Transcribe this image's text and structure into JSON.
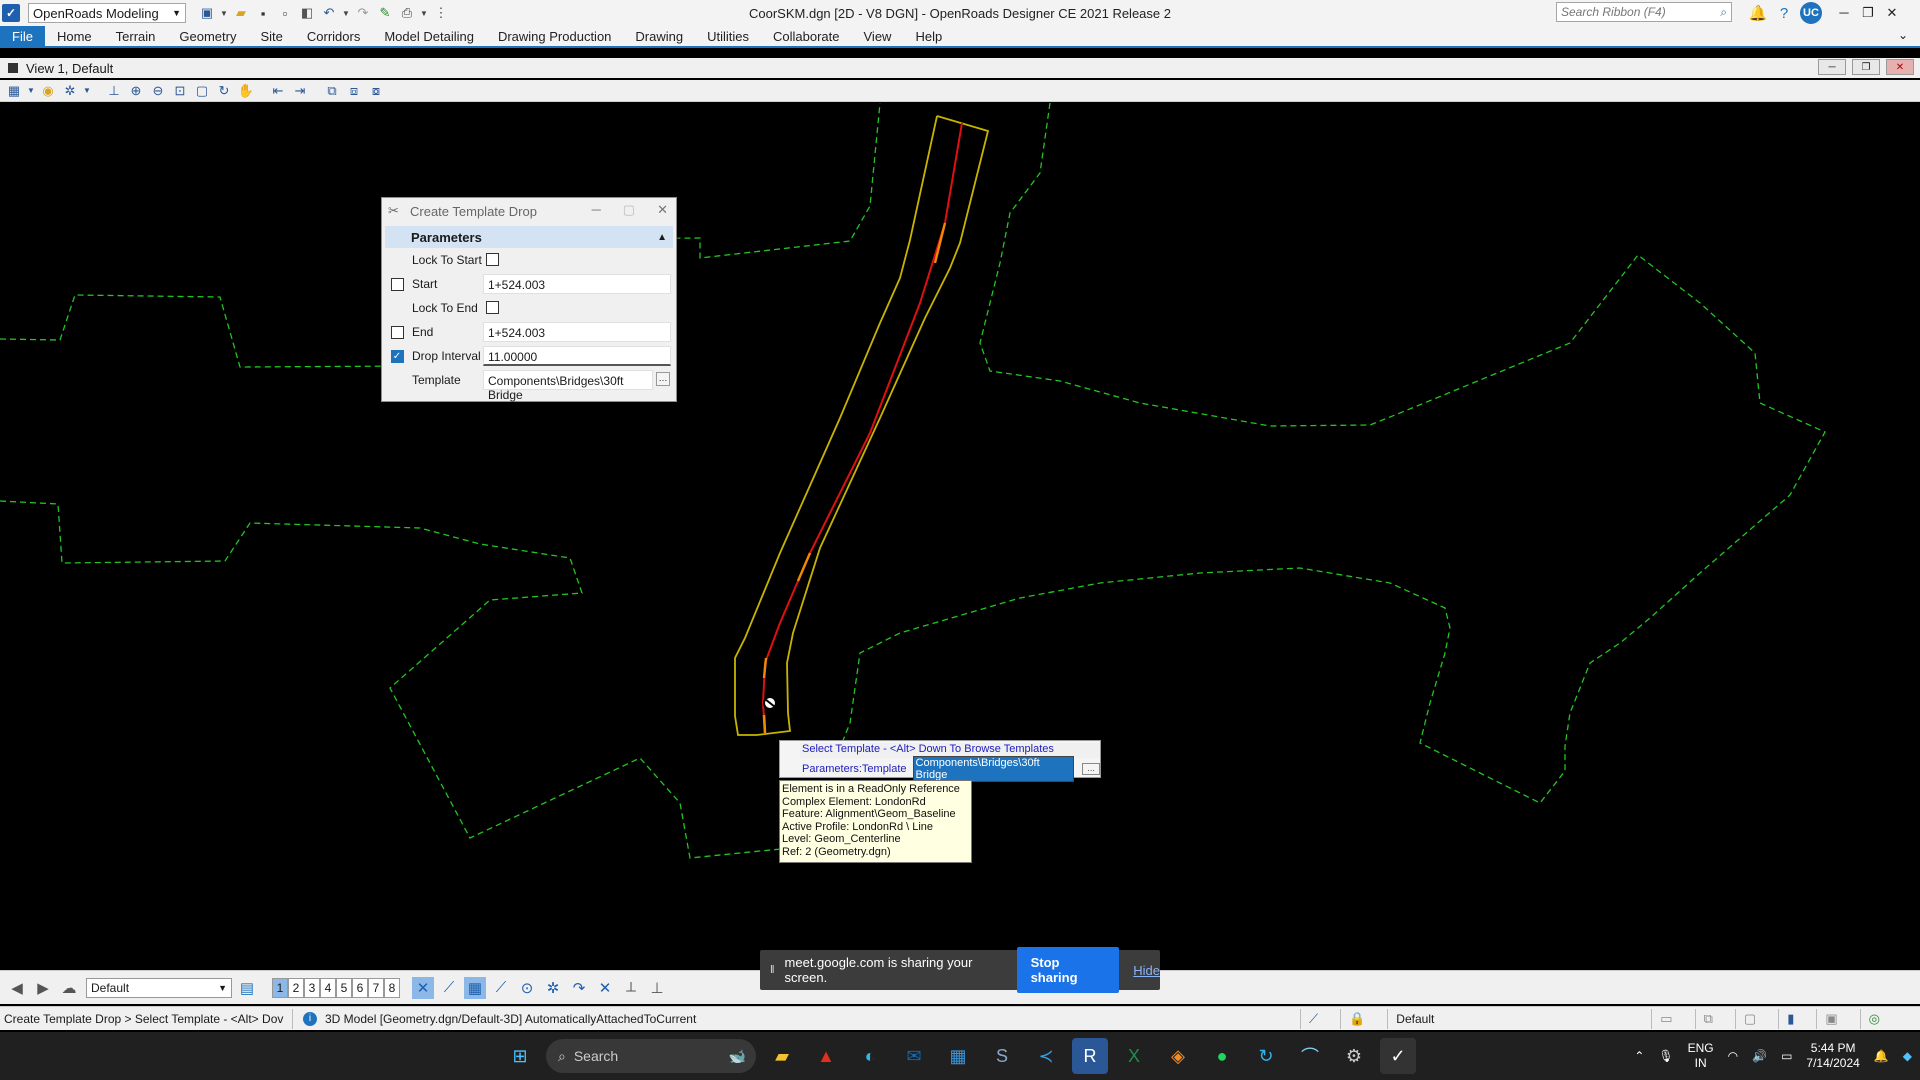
{
  "titlebar": {
    "workflow": "OpenRoads Modeling",
    "window_title": "CoorSKM.dgn [2D - V8 DGN] - OpenRoads Designer CE 2021 Release 2",
    "search_placeholder": "Search Ribbon (F4)",
    "user_initials": "UC"
  },
  "ribbon": {
    "tabs": [
      "File",
      "Home",
      "Terrain",
      "Geometry",
      "Site",
      "Corridors",
      "Model Detailing",
      "Drawing Production",
      "Drawing",
      "Utilities",
      "Collaborate",
      "View",
      "Help"
    ]
  },
  "view": {
    "title": "View 1, Default"
  },
  "dialog": {
    "title": "Create Template Drop",
    "section": "Parameters",
    "rows": {
      "lock_start": {
        "label": "Lock To Start"
      },
      "start": {
        "label": "Start",
        "value": "1+524.003"
      },
      "lock_end": {
        "label": "Lock To End"
      },
      "end": {
        "label": "End",
        "value": "1+524.003"
      },
      "drop_interval": {
        "label": "Drop Interval",
        "value": "11.00000",
        "checked": true
      },
      "template": {
        "label": "Template",
        "value": "Components\\Bridges\\30ft Bridge"
      }
    }
  },
  "prompt": {
    "line1": "Select Template - <Alt> Down To Browse Templates",
    "label": "Parameters:Template",
    "value": "Components\\Bridges\\30ft Bridge"
  },
  "tooltip": {
    "lines": [
      "Element is in a ReadOnly Reference",
      "Complex  Element:  LondonRd",
      "Feature:  Alignment\\Geom_Baseline",
      "Active Profile:  LondonRd \\ Line",
      "Level:  Geom_Centerline",
      "Ref: 2 (Geometry.dgn)"
    ]
  },
  "bottombar": {
    "level": "Default",
    "views": [
      "1",
      "2",
      "3",
      "4",
      "5",
      "6",
      "7",
      "8"
    ],
    "active_view": "1"
  },
  "share_banner": {
    "text": "meet.google.com is sharing your screen.",
    "stop": "Stop sharing",
    "hide": "Hide"
  },
  "statusbar": {
    "prompt": "Create Template Drop > Select Template - <Alt> Dov",
    "message": "3D Model [Geometry.dgn/Default-3D] AutomaticallyAttachedToCurrent",
    "level": "Default"
  },
  "taskbar": {
    "search": "Search",
    "lang_line1": "ENG",
    "lang_line2": "IN",
    "time": "5:44 PM",
    "date": "7/14/2024"
  },
  "colors": {
    "accent": "#1e73be",
    "boundary": "#22c522",
    "road_edge": "#c8b400",
    "centerline": "#e01010"
  }
}
